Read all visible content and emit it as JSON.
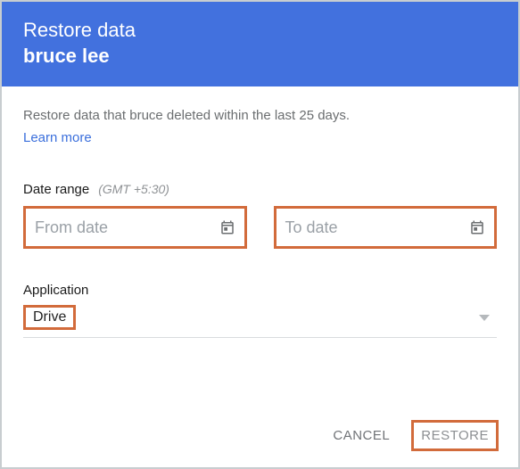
{
  "header": {
    "title": "Restore data",
    "subtitle": "bruce lee"
  },
  "description": "Restore data that bruce deleted within the last 25 days.",
  "learn_more": "Learn more",
  "date_range": {
    "label": "Date range",
    "timezone": "(GMT +5:30)",
    "from_placeholder": "From date",
    "to_placeholder": "To date"
  },
  "application": {
    "label": "Application",
    "selected": "Drive"
  },
  "footer": {
    "cancel": "CANCEL",
    "restore": "RESTORE"
  },
  "colors": {
    "brand_blue": "#4271de",
    "highlight_orange": "#d26b3b",
    "link_blue": "#3b6fdc"
  }
}
